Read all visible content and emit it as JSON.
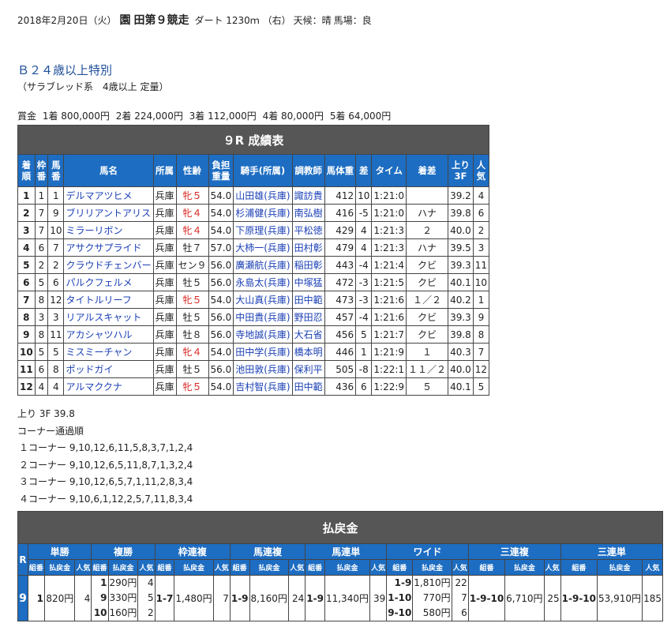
{
  "header": {
    "date": "2018年2月20日（火）",
    "place": "園",
    "race": "田第９競走",
    "course": "ダート 1230ｍ （右）",
    "weather": "天候：晴",
    "track": "馬場：良"
  },
  "race": {
    "title": "Ｂ２４歳以上特別",
    "subtitle": "（サラブレッド系　4歳以上 定量）"
  },
  "prize": {
    "label": "賞金",
    "items": [
      "1着 800,000円",
      "2着 224,000円",
      "3着 112,000円",
      "4着 80,000円",
      "5着 64,000円"
    ]
  },
  "results": {
    "caption": "９R 成績表",
    "headers": {
      "rank": "着順",
      "frame": "枠番",
      "num": "馬番",
      "horse": "馬名",
      "stable": "所属",
      "sexage": "性齢",
      "weight": "負担重量",
      "jockey": "騎手(所属)",
      "trainer": "調教師",
      "bodyweight": "馬体重",
      "diff": "差",
      "time": "タイム",
      "margin": "着差",
      "last3f": "上り3F",
      "pop": "人気"
    },
    "rows": [
      {
        "rank": "1",
        "frame": "1",
        "num": "1",
        "horse": "デルマアツヒメ",
        "stable": "兵庫",
        "sexage": "牝５",
        "female": true,
        "weight": "54.0",
        "jockey": "山田雄(兵庫)",
        "trainer": "諏訪貴",
        "bw": "412",
        "diff": "10",
        "time": "1:21:0",
        "margin": "",
        "last3f": "39.2",
        "pop": "4"
      },
      {
        "rank": "2",
        "frame": "7",
        "num": "9",
        "horse": "ブリリアントアリス",
        "stable": "兵庫",
        "sexage": "牝４",
        "female": true,
        "weight": "54.0",
        "jockey": "杉浦健(兵庫)",
        "trainer": "南弘樹",
        "bw": "416",
        "diff": "-5",
        "time": "1:21:0",
        "margin": "ハナ",
        "last3f": "39.8",
        "pop": "6"
      },
      {
        "rank": "3",
        "frame": "7",
        "num": "10",
        "horse": "ミラーリボン",
        "stable": "兵庫",
        "sexage": "牝４",
        "female": true,
        "weight": "54.0",
        "jockey": "下原理(兵庫)",
        "trainer": "平松徳",
        "bw": "429",
        "diff": "4",
        "time": "1:21:3",
        "margin": "２",
        "last3f": "40.0",
        "pop": "2"
      },
      {
        "rank": "4",
        "frame": "6",
        "num": "7",
        "horse": "アサクサプライド",
        "stable": "兵庫",
        "sexage": "牡７",
        "female": false,
        "weight": "57.0",
        "jockey": "大柿一(兵庫)",
        "trainer": "田村彰",
        "bw": "479",
        "diff": "4",
        "time": "1:21:3",
        "margin": "ハナ",
        "last3f": "39.5",
        "pop": "3"
      },
      {
        "rank": "5",
        "frame": "2",
        "num": "2",
        "horse": "クラウドチェンバー",
        "stable": "兵庫",
        "sexage": "セン９",
        "female": false,
        "weight": "56.0",
        "jockey": "廣瀬航(兵庫)",
        "trainer": "稲田彰",
        "bw": "443",
        "diff": "-4",
        "time": "1:21:4",
        "margin": "クビ",
        "last3f": "39.3",
        "pop": "11"
      },
      {
        "rank": "6",
        "frame": "5",
        "num": "6",
        "horse": "パルクフェルメ",
        "stable": "兵庫",
        "sexage": "牡５",
        "female": false,
        "weight": "56.0",
        "jockey": "永島太(兵庫)",
        "trainer": "中塚猛",
        "bw": "472",
        "diff": "-3",
        "time": "1:21:5",
        "margin": "クビ",
        "last3f": "40.1",
        "pop": "10"
      },
      {
        "rank": "7",
        "frame": "8",
        "num": "12",
        "horse": "タイトルリーフ",
        "stable": "兵庫",
        "sexage": "牝５",
        "female": true,
        "weight": "54.0",
        "jockey": "大山真(兵庫)",
        "trainer": "田中範",
        "bw": "473",
        "diff": "-3",
        "time": "1:21:6",
        "margin": "１／２",
        "last3f": "40.2",
        "pop": "1"
      },
      {
        "rank": "8",
        "frame": "3",
        "num": "3",
        "horse": "リアルスキャット",
        "stable": "兵庫",
        "sexage": "牡５",
        "female": false,
        "weight": "56.0",
        "jockey": "中田貴(兵庫)",
        "trainer": "野田忍",
        "bw": "457",
        "diff": "-4",
        "time": "1:21:6",
        "margin": "クビ",
        "last3f": "39.3",
        "pop": "9"
      },
      {
        "rank": "9",
        "frame": "8",
        "num": "11",
        "horse": "アカシャツハル",
        "stable": "兵庫",
        "sexage": "牡８",
        "female": false,
        "weight": "56.0",
        "jockey": "寺地誠(兵庫)",
        "trainer": "大石省",
        "bw": "456",
        "diff": "5",
        "time": "1:21:7",
        "margin": "クビ",
        "last3f": "39.8",
        "pop": "8"
      },
      {
        "rank": "10",
        "frame": "5",
        "num": "5",
        "horse": "ミスミーチャン",
        "stable": "兵庫",
        "sexage": "牝４",
        "female": true,
        "weight": "54.0",
        "jockey": "田中学(兵庫)",
        "trainer": "橋本明",
        "bw": "446",
        "diff": "1",
        "time": "1:21:9",
        "margin": "１",
        "last3f": "40.3",
        "pop": "7"
      },
      {
        "rank": "11",
        "frame": "6",
        "num": "8",
        "horse": "ポッドガイ",
        "stable": "兵庫",
        "sexage": "牡５",
        "female": false,
        "weight": "56.0",
        "jockey": "池田敦(兵庫)",
        "trainer": "保利平",
        "bw": "505",
        "diff": "-8",
        "time": "1:22:1",
        "margin": "１１／２",
        "last3f": "40.0",
        "pop": "12"
      },
      {
        "rank": "12",
        "frame": "4",
        "num": "4",
        "horse": "アルマククナ",
        "stable": "兵庫",
        "sexage": "牝５",
        "female": true,
        "weight": "54.0",
        "jockey": "吉村智(兵庫)",
        "trainer": "田中範",
        "bw": "436",
        "diff": "6",
        "time": "1:22:9",
        "margin": "５",
        "last3f": "40.1",
        "pop": "5"
      }
    ]
  },
  "notes": {
    "last3f": "上り 3F 39.8",
    "corner_title": "コーナー通過順",
    "corners": [
      "１コーナー 9,10,12,6,11,5,8,3,7,1,2,4",
      "２コーナー 9,10,12,6,5,11,8,7,1,3,2,4",
      "３コーナー 9,10,12,6,5,7,1,11,2,8,3,4",
      "４コーナー 9,10,6,1,12,2,5,7,11,8,3,4"
    ]
  },
  "payout": {
    "caption": "払戻金",
    "r_label": "R",
    "race_no": "9",
    "bet_types": [
      "単勝",
      "複勝",
      "枠連複",
      "馬連複",
      "馬連単",
      "ワイド",
      "三連複",
      "三連単"
    ],
    "sub": {
      "combo": "組番",
      "pay": "払戻金",
      "pop": "人気"
    },
    "win": {
      "combo": "1",
      "pay": "820円",
      "pop": "4"
    },
    "place": [
      {
        "combo": "1",
        "pay": "290円",
        "pop": "4"
      },
      {
        "combo": "9",
        "pay": "330円",
        "pop": "5"
      },
      {
        "combo": "10",
        "pay": "160円",
        "pop": "2"
      }
    ],
    "bracket_q": {
      "combo": "1-7",
      "pay": "1,480円",
      "pop": "7"
    },
    "quinella": {
      "combo": "1-9",
      "pay": "8,160円",
      "pop": "24"
    },
    "exacta": {
      "combo": "1-9",
      "pay": "11,340円",
      "pop": "39"
    },
    "wide": [
      {
        "combo": "1-9",
        "pay": "1,810円",
        "pop": "22"
      },
      {
        "combo": "1-10",
        "pay": "770円",
        "pop": "7"
      },
      {
        "combo": "9-10",
        "pay": "580円",
        "pop": "6"
      }
    ],
    "trio": {
      "combo": "1-9-10",
      "pay": "6,710円",
      "pop": "25"
    },
    "trifecta": {
      "combo": "1-9-10",
      "pay": "53,910円",
      "pop": "185"
    }
  }
}
